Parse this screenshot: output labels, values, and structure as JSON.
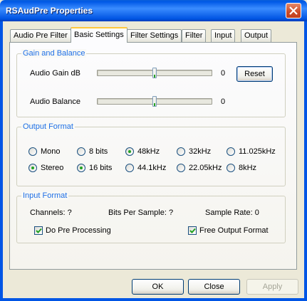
{
  "window": {
    "title": "RSAudPre Properties"
  },
  "tabs": [
    {
      "label": "Audio Pre Filter"
    },
    {
      "label": "Basic Settings",
      "active": true
    },
    {
      "label": "Filter Settings"
    },
    {
      "label": "Filter"
    },
    {
      "label": "Input"
    },
    {
      "label": "Output"
    }
  ],
  "gain_balance": {
    "title": "Gain and Balance",
    "gain_label": "Audio Gain dB",
    "gain_value": "0",
    "balance_label": "Audio Balance",
    "balance_value": "0",
    "reset_label": "Reset"
  },
  "output_format": {
    "title": "Output Format",
    "channels": [
      {
        "label": "Mono",
        "checked": false
      },
      {
        "label": "Stereo",
        "checked": true
      }
    ],
    "bits": [
      {
        "label": "8 bits",
        "checked": false
      },
      {
        "label": "16 bits",
        "checked": true
      }
    ],
    "rates": [
      {
        "label": "48kHz",
        "checked": true
      },
      {
        "label": "32kHz",
        "checked": false
      },
      {
        "label": "11.025kHz",
        "checked": false
      },
      {
        "label": "44.1kHz",
        "checked": false
      },
      {
        "label": "22.05kHz",
        "checked": false
      },
      {
        "label": "8kHz",
        "checked": false
      }
    ]
  },
  "input_format": {
    "title": "Input Format",
    "channels_text": "Channels: ?",
    "bits_text": "Bits Per Sample: ?",
    "rate_text": "Sample Rate: 0",
    "pre_processing_label": "Do Pre Processing",
    "pre_processing_checked": true,
    "free_output_label": "Free Output Format",
    "free_output_checked": true
  },
  "buttons": {
    "ok": "OK",
    "close": "Close",
    "apply": "Apply"
  }
}
